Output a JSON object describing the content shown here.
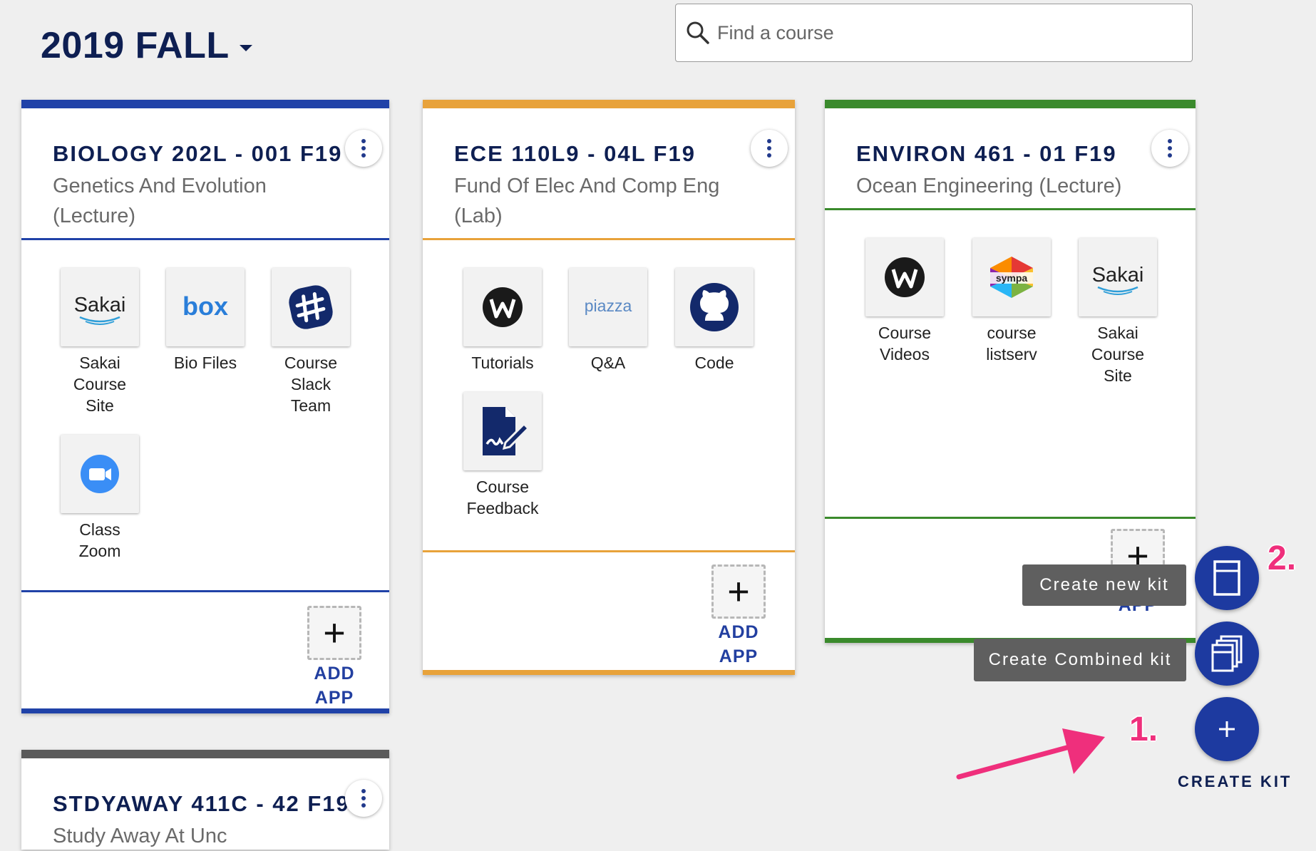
{
  "term": {
    "label": "2019 FALL"
  },
  "search": {
    "placeholder": "Find a course"
  },
  "cards": [
    {
      "title": "BIOLOGY 202L - 001 F19",
      "subtitle": "Genetics And Evolution (Lecture)",
      "color": "#2042a8",
      "apps": [
        {
          "label": "Sakai Course Site",
          "icon": "sakai-logo"
        },
        {
          "label": "Bio Files",
          "icon": "box-logo"
        },
        {
          "label": "Course Slack Team",
          "icon": "slack-logo"
        },
        {
          "label": "Class Zoom",
          "icon": "zoom-logo"
        }
      ],
      "add_app": "ADD APP"
    },
    {
      "title": "ECE 110L9 - 04L F19",
      "subtitle": "Fund Of Elec And Comp Eng (Lab)",
      "color": "#e8a23a",
      "apps": [
        {
          "label": "Tutorials",
          "icon": "warpwire-logo"
        },
        {
          "label": "Q&A",
          "icon": "piazza-logo"
        },
        {
          "label": "Code",
          "icon": "github-logo"
        },
        {
          "label": "Course Feedback",
          "icon": "feedback-form-icon"
        }
      ],
      "add_app": "ADD APP"
    },
    {
      "title": "ENVIRON 461 - 01 F19",
      "subtitle": "Ocean Engineering (Lecture)",
      "color": "#3a8a2c",
      "apps": [
        {
          "label": "Course Videos",
          "icon": "warpwire-logo"
        },
        {
          "label": "course listserv",
          "icon": "sympa-logo"
        },
        {
          "label": "Sakai Course Site",
          "icon": "sakai-logo"
        }
      ],
      "add_app": "APP"
    },
    {
      "title": "STDYAWAY 411C - 42 F19",
      "subtitle": "Study Away At Unc",
      "color": "#5a5a5a"
    }
  ],
  "fab": {
    "create_new_kit": "Create new kit",
    "create_combined_kit": "Create Combined kit",
    "create_kit": "CREATE KIT"
  },
  "annotations": {
    "step1": "1.",
    "step2": "2."
  },
  "logos": {
    "sakai": "Sakai",
    "box": "box",
    "piazza": "piazza",
    "sympa": "sympa"
  }
}
